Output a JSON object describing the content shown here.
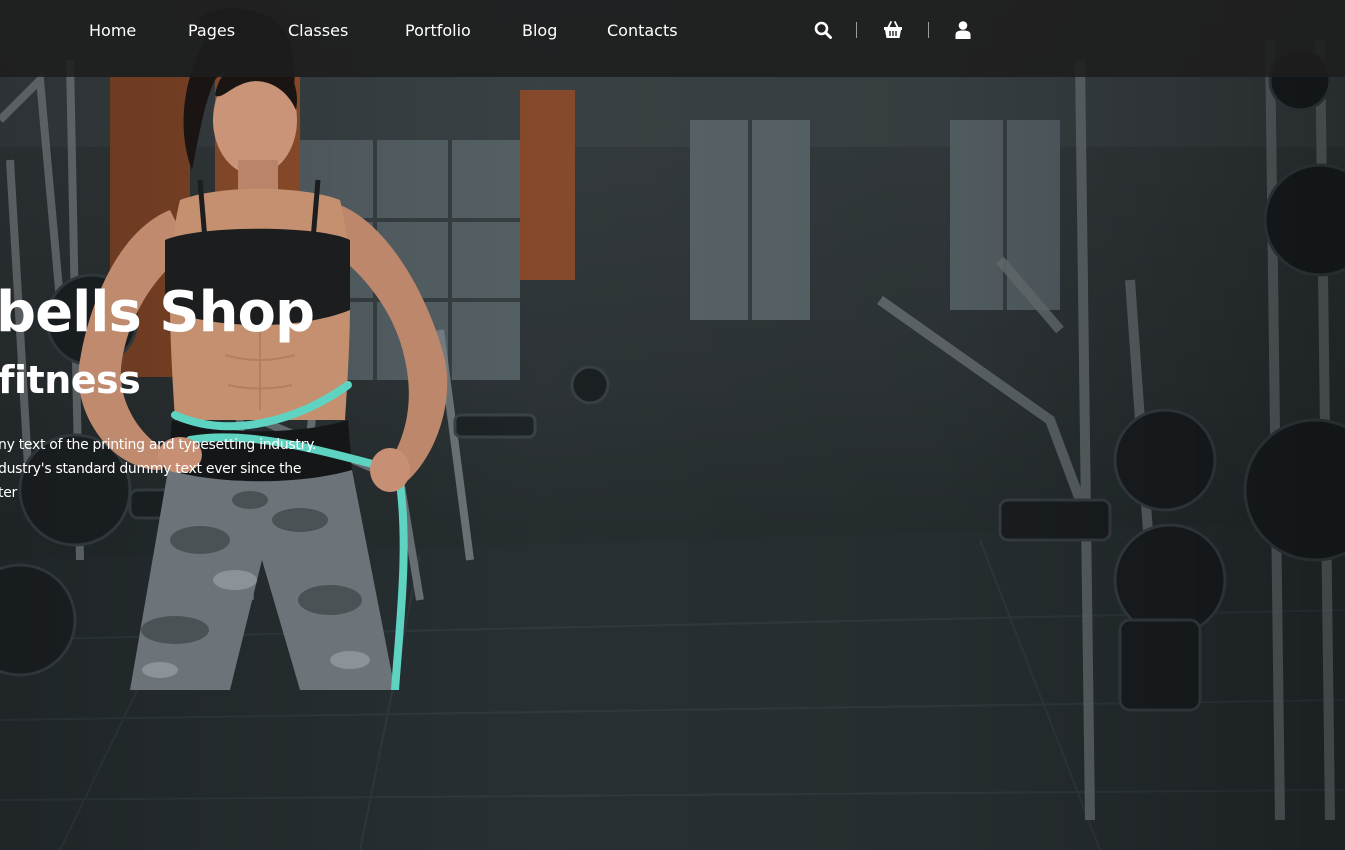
{
  "nav": {
    "items": [
      {
        "label": "Home"
      },
      {
        "label": "Pages"
      },
      {
        "label": "Classes"
      },
      {
        "label": "Portfolio"
      },
      {
        "label": "Blog"
      },
      {
        "label": "Contacts"
      }
    ],
    "icons": [
      "search-icon",
      "basket-icon",
      "user-icon"
    ]
  },
  "hero": {
    "headline": "bells Shop",
    "subheadline": "fitness",
    "body_lines": [
      "ny text of the printing and typesetting industry.",
      "dustry's standard dummy text ever since the",
      "ter"
    ],
    "image": "gym-fitness-model-measuring-waist"
  },
  "colors": {
    "topbar": "#1e1e1e",
    "text": "#ffffff",
    "tape": "#5fd3c1"
  }
}
